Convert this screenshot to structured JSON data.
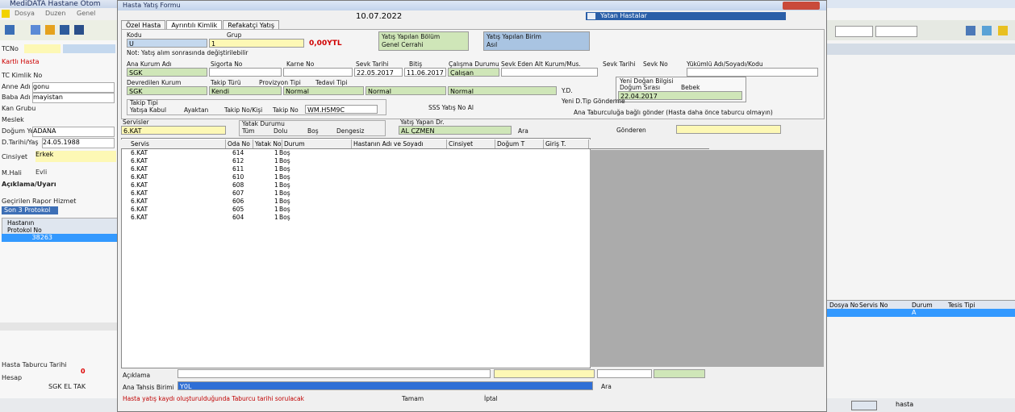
{
  "app": {
    "title": "MediDATA Hastane Otom",
    "menu": [
      "Dosya",
      "Duzen",
      "Genel"
    ],
    "left_labels": [
      "TCNo",
      "Kartlı Hasta",
      "TC Kimlik No",
      "Anne Adı",
      "Baba Adı",
      "Kan Grubu",
      "Meslek",
      "Doğum Yeri",
      "D.Tarihi/Yaş",
      "Cinsiyet",
      "M.Hali",
      "Açıklama/Uyarı",
      "Geçirilen Rapor Hizmet"
    ],
    "left_values": {
      "anne": "gonu",
      "baba": "mayistan",
      "dogum_yeri": "ADANA",
      "dtarihi": "24.05.1988",
      "cinsiyet": "Erkek",
      "mhali": "Evli",
      "protokol_tab": "Son 3 Protokol",
      "protokol_no": "38263"
    },
    "protokol_headers": [
      "Hastanın",
      "Protokol No"
    ],
    "bottom_left": {
      "hesap_label": "Hesap",
      "hasta_label": "Hasta Taburcu Tarihi",
      "sgk_label": "SGK EL TAK",
      "count": "0"
    },
    "right": {
      "grid_headers": [
        "Dosya No",
        "Servis No",
        "Durum",
        "Tesis Tipi"
      ],
      "row_value": "A",
      "status": "hasta"
    }
  },
  "dialog": {
    "title": "Hasta Yatış Formu",
    "date": "10.07.2022",
    "tabs": [
      "Özel Hasta",
      "Ayrıntılı Kimlik",
      "Refakatçi Yatış"
    ],
    "fields": {
      "kodu_label": "Kodu",
      "kodu_value": "U",
      "grup_label": "Grup",
      "grup_value": "1",
      "total": "0,00YTL",
      "note": "Not: Yatış alım sonrasında değiştirilebilir",
      "yatis_bolumu_label": "Yatış Yapılan Bölüm",
      "yatis_bolumu_value": "Genel Cerrahi",
      "yatis_birimi_label": "Yatış Yapılan Birim",
      "yatis_birimi_value": "Asıl",
      "ana_kurum_label": "Ana Kurum Adı",
      "ana_kurum_value": "SGK",
      "sigorta_label": "Sigorta No",
      "karne_label": "Karne No",
      "sevk_label": "Sevk Tarihi",
      "sevk_value": "22.05.2017",
      "bitis_label": "Bitiş",
      "bitis_value": "11.06.2017",
      "calisma_label": "Çalışma Durumu",
      "calisma_value": "Çalışan",
      "sevk_eden_label": "Sevk Eden Alt Kurum/Mus.",
      "sevk_tarihi2_label": "Sevk Tarihi",
      "sevk_no_label": "Sevk No",
      "yukumlu_label": "Yükümlü Adı/Soyadı/Kodu",
      "devreden_label": "Devredilen Kurum",
      "devreden_value": "SGK",
      "takip_label": "Takip Türü",
      "takip_value": "Normal",
      "provizyon_label": "Provizyon Tipi",
      "provizyon_value": "Normal",
      "tedavi_label": "Tedavi Tipi",
      "tedavi_value": "Normal",
      "yatis_turu_value": "Kendi",
      "yd_label": "Y.D.",
      "yeni_dogan_label": "Yeni Doğan Bilgisi",
      "dogum_sirasi_label": "Doğum Sırası",
      "bebek_label": "Bebek",
      "yeni_dogan_gonder": "Yeni D.Tip Gönderme",
      "yeni_dogan_date": "22.04.2017",
      "takip_tipi_label": "Takip Tipi",
      "radio_options": [
        "Yatışa Kabul",
        "Ayaktan",
        "Takip No/Kişi"
      ],
      "takip_no_label": "Takip No",
      "takip_no_value": "WM.H5M9C",
      "sss_button": "SSS Yatış No Al",
      "ana_tabur_check": "Ana Taburculuğa bağlı gönder (Hasta daha önce taburcu olmayın)",
      "servisler_label": "Servisler",
      "servis_value": "6.KAT",
      "yatak_durumu_label": "Yatak Durumu",
      "yatak_options": [
        "Tüm",
        "Dolu",
        "Boş",
        "Dengesiz"
      ],
      "yatis_yapan_label": "Yatış Yapan Dr.",
      "yatis_yapan_value": "AL ÇZMEN",
      "ara_button": "Ara",
      "gonderen_label": "Gönderen"
    },
    "grid": {
      "headers": [
        "Servis",
        "Oda No",
        "Yatak No",
        "Durum",
        "Hastanın Adı ve Soyadı",
        "Cinsiyet",
        "Doğum T",
        "Giriş T."
      ],
      "rows": [
        {
          "servis": "6.KAT",
          "oda": "614",
          "yatak": "1",
          "durum": "Boş"
        },
        {
          "servis": "6.KAT",
          "oda": "612",
          "yatak": "1",
          "durum": "Boş"
        },
        {
          "servis": "6.KAT",
          "oda": "611",
          "yatak": "1",
          "durum": "Boş"
        },
        {
          "servis": "6.KAT",
          "oda": "610",
          "yatak": "1",
          "durum": "Boş"
        },
        {
          "servis": "6.KAT",
          "oda": "608",
          "yatak": "1",
          "durum": "Boş"
        },
        {
          "servis": "6.KAT",
          "oda": "607",
          "yatak": "1",
          "durum": "Boş"
        },
        {
          "servis": "6.KAT",
          "oda": "606",
          "yatak": "1",
          "durum": "Boş"
        },
        {
          "servis": "6.KAT",
          "oda": "605",
          "yatak": "1",
          "durum": "Boş"
        },
        {
          "servis": "6.KAT",
          "oda": "604",
          "yatak": "1",
          "durum": "Boş"
        }
      ]
    },
    "bottom": {
      "aciklama_label": "Açıklama",
      "ana_tahsis_label": "Ana Tahsis Birimi",
      "ana_tahsis_value": "Y0L",
      "ara_button": "Ara",
      "warning": "Hasta yatış kaydı oluşturulduğunda Taburcu tarihi sorulacak",
      "tamam_button": "Tamam",
      "iptal_button": "İptal"
    },
    "popup_title": "Yatan Hastalar"
  }
}
